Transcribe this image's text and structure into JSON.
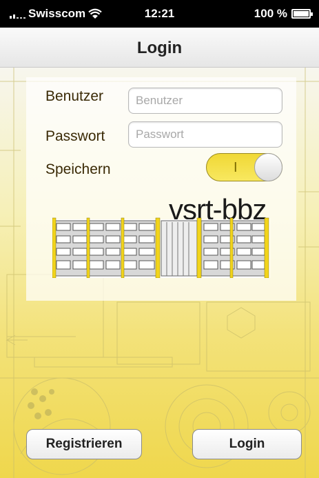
{
  "status_bar": {
    "carrier": "Swisscom",
    "time": "12:21",
    "battery_text": "100 %",
    "battery_level": 1.0,
    "wifi_icon": "wifi-icon",
    "signal_icon": "signal-icon",
    "battery_icon": "battery-charging-icon"
  },
  "nav": {
    "title": "Login"
  },
  "form": {
    "username_label": "Benutzer",
    "username_placeholder": "Benutzer",
    "username_value": "",
    "password_label": "Passwort",
    "password_placeholder": "Passwort",
    "password_value": "",
    "remember_label": "Speichern",
    "remember_on": true,
    "remember_on_mark": "I"
  },
  "logo": {
    "text": "vsrt-bbz"
  },
  "buttons": {
    "register": "Registrieren",
    "login": "Login"
  },
  "colors": {
    "accent": "#f0d835",
    "statusbar": "#000000"
  }
}
